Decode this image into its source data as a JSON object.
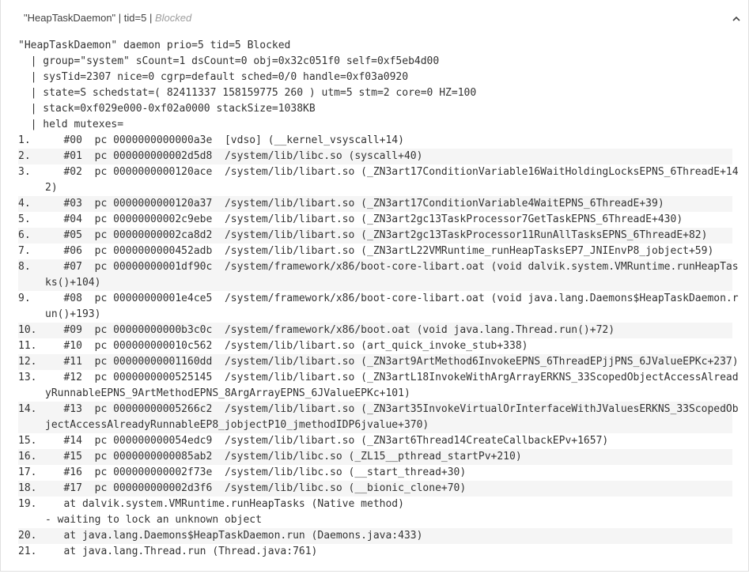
{
  "header": {
    "thread_name": "\"HeapTaskDaemon\"",
    "sep1": " | ",
    "tid": "tid=5",
    "sep2": " | ",
    "status": "Blocked"
  },
  "pre_lines": [
    "\"HeapTaskDaemon\" daemon prio=5 tid=5 Blocked",
    "  | group=\"system\" sCount=1 dsCount=0 obj=0x32c051f0 self=0xf5eb4d00",
    "  | sysTid=2307 nice=0 cgrp=default sched=0/0 handle=0xf03a0920",
    "  | state=S schedstat=( 82411337 158159775 260 ) utm=5 stm=2 core=0 HZ=100",
    "  | stack=0xf029e000-0xf02a0000 stackSize=1038KB",
    "  | held mutexes="
  ],
  "frames": [
    {
      "num": "1.",
      "line1": "   #00  pc 0000000000000a3e  [vdso] (__kernel_vsyscall+14)",
      "line2": ""
    },
    {
      "num": "2.",
      "line1": "   #01  pc 000000000002d5d8  /system/lib/libc.so (syscall+40)",
      "line2": ""
    },
    {
      "num": "3.",
      "line1": "   #02  pc 0000000000120ace  /system/lib/libart.so (_ZN3art17ConditionVariable16WaitHoldingLocksEPNS_6ThreadE+14",
      "line2": "2)"
    },
    {
      "num": "4.",
      "line1": "   #03  pc 0000000000120a37  /system/lib/libart.so (_ZN3art17ConditionVariable4WaitEPNS_6ThreadE+39)",
      "line2": ""
    },
    {
      "num": "5.",
      "line1": "   #04  pc 00000000002c9ebe  /system/lib/libart.so (_ZN3art2gc13TaskProcessor7GetTaskEPNS_6ThreadE+430)",
      "line2": ""
    },
    {
      "num": "6.",
      "line1": "   #05  pc 00000000002ca8d2  /system/lib/libart.so (_ZN3art2gc13TaskProcessor11RunAllTasksEPNS_6ThreadE+82)",
      "line2": ""
    },
    {
      "num": "7.",
      "line1": "   #06  pc 0000000000452adb  /system/lib/libart.so (_ZN3artL22VMRuntime_runHeapTasksEP7_JNIEnvP8_jobject+59)",
      "line2": ""
    },
    {
      "num": "8.",
      "line1": "   #07  pc 00000000001df90c  /system/framework/x86/boot-core-libart.oat (void dalvik.system.VMRuntime.runHeapTas",
      "line2": "ks()+104)"
    },
    {
      "num": "9.",
      "line1": "   #08  pc 00000000001e4ce5  /system/framework/x86/boot-core-libart.oat (void java.lang.Daemons$HeapTaskDaemon.r",
      "line2": "un()+193)"
    },
    {
      "num": "10.",
      "line1": "   #09  pc 00000000000b3c0c  /system/framework/x86/boot.oat (void java.lang.Thread.run()+72)",
      "line2": ""
    },
    {
      "num": "11.",
      "line1": "   #10  pc 000000000010c562  /system/lib/libart.so (art_quick_invoke_stub+338)",
      "line2": ""
    },
    {
      "num": "12.",
      "line1": "   #11  pc 00000000001160dd  /system/lib/libart.so (_ZN3art9ArtMethod6InvokeEPNS_6ThreadEPjjPNS_6JValueEPKc+237)",
      "line2": ""
    },
    {
      "num": "13.",
      "line1": "   #12  pc 0000000000525145  /system/lib/libart.so (_ZN3artL18InvokeWithArgArrayERKNS_33ScopedObjectAccessAlread",
      "line2": "yRunnableEPNS_9ArtMethodEPNS_8ArgArrayEPNS_6JValueEPKc+101)"
    },
    {
      "num": "14.",
      "line1": "   #13  pc 00000000005266c2  /system/lib/libart.so (_ZN3art35InvokeVirtualOrInterfaceWithJValuesERKNS_33ScopedOb",
      "line2": "jectAccessAlreadyRunnableEP8_jobjectP10_jmethodIDP6jvalue+370)"
    },
    {
      "num": "15.",
      "line1": "   #14  pc 000000000054edc9  /system/lib/libart.so (_ZN3art6Thread14CreateCallbackEPv+1657)",
      "line2": ""
    },
    {
      "num": "16.",
      "line1": "   #15  pc 0000000000085ab2  /system/lib/libc.so (_ZL15__pthread_startPv+210)",
      "line2": ""
    },
    {
      "num": "17.",
      "line1": "   #16  pc 000000000002f73e  /system/lib/libc.so (__start_thread+30)",
      "line2": ""
    },
    {
      "num": "18.",
      "line1": "   #17  pc 000000000002d3f6  /system/lib/libc.so (__bionic_clone+70)",
      "line2": ""
    },
    {
      "num": "19.",
      "line1": "   at dalvik.system.VMRuntime.runHeapTasks (Native method)",
      "line2": "- waiting to lock an unknown object"
    },
    {
      "num": "20.",
      "line1": "   at java.lang.Daemons$HeapTaskDaemon.run (Daemons.java:433)",
      "line2": ""
    },
    {
      "num": "21.",
      "line1": "   at java.lang.Thread.run (Thread.java:761)",
      "line2": ""
    }
  ],
  "icons": {
    "collapse": "chevron-up-icon"
  }
}
